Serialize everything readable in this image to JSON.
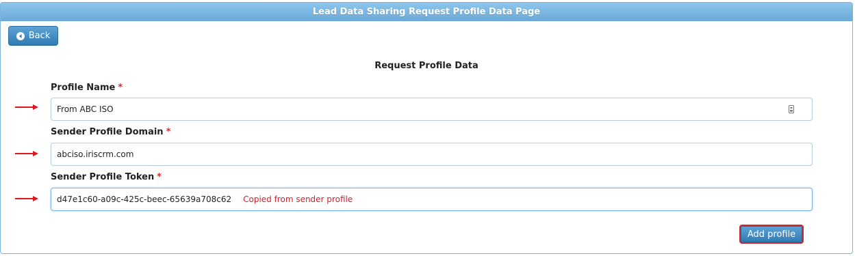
{
  "page": {
    "title": "Lead Data Sharing Request Profile Data Page"
  },
  "back_button": {
    "label": "Back",
    "icon": "circle-arrow-left-icon"
  },
  "form": {
    "section_title": "Request Profile Data",
    "required_marker": "*",
    "fields": [
      {
        "label": "Profile Name",
        "value": "From ABC ISO"
      },
      {
        "label": "Sender Profile Domain",
        "value": "abciso.iriscrm.com"
      },
      {
        "label": "Sender Profile Token",
        "value": "d47e1c60-a09c-425c-beec-65639a708c62",
        "note": "Copied from sender profile"
      }
    ],
    "submit_label": "Add profile"
  },
  "colors": {
    "header": "#79b6e2",
    "button": "#3d89c4",
    "required": "#d8282f",
    "annotation": "#e0141c"
  }
}
